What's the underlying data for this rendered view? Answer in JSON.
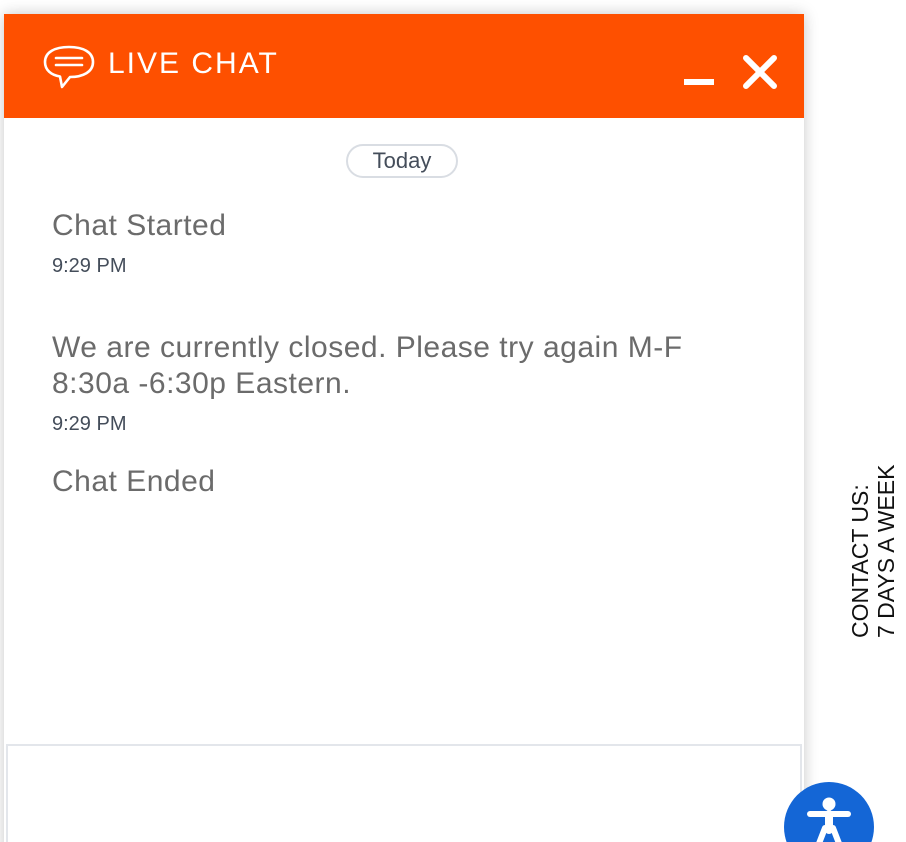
{
  "header": {
    "title": "LIVE CHAT",
    "icon": "chat-bubble-icon",
    "minimize_icon": "minimize-icon",
    "close_icon": "close-icon"
  },
  "transcript": {
    "date_label": "Today",
    "started": {
      "text": "Chat Started",
      "time": "9:29 PM"
    },
    "message": {
      "text": "We are currently closed. Please try again M-F 8:30a -6:30p Eastern.",
      "time": "9:29 PM"
    },
    "ended": {
      "text": "Chat Ended"
    }
  },
  "side_tab": {
    "line1": "CONTACT US:",
    "line2": "7 DAYS A WEEK"
  },
  "accessibility": {
    "icon": "accessibility-person-icon"
  },
  "colors": {
    "header_bg": "#fe5000",
    "text_gray": "#6b6b6b",
    "time_gray": "#444d5a",
    "accessibility_blue": "#1466d6"
  }
}
